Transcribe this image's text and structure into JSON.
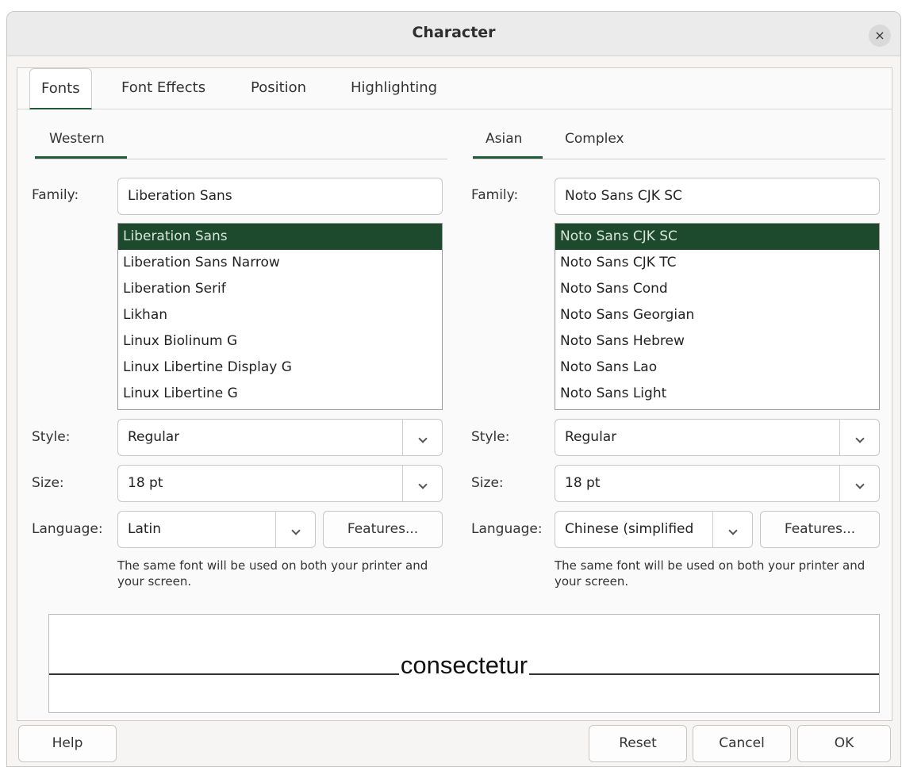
{
  "window": {
    "title": "Character",
    "close_symbol": "×"
  },
  "tabs": [
    "Fonts",
    "Font Effects",
    "Position",
    "Highlighting"
  ],
  "western": {
    "tab_label": "Western",
    "family_label": "Family:",
    "family_value": "Liberation Sans",
    "font_list": [
      "Liberation Sans",
      "Liberation Sans Narrow",
      "Liberation Serif",
      "Likhan",
      "Linux Biolinum G",
      "Linux Libertine Display G",
      "Linux Libertine G"
    ],
    "selected_index": 0,
    "style_label": "Style:",
    "style_value": "Regular",
    "size_label": "Size:",
    "size_value": "18 pt",
    "language_label": "Language:",
    "language_value": "Latin",
    "features_label": "Features...",
    "note": "The same font will be used on both your printer and your screen."
  },
  "asian": {
    "tab_label": "Asian",
    "complex_tab_label": "Complex",
    "family_label": "Family:",
    "family_value": "Noto Sans CJK SC",
    "font_list": [
      "Noto Sans CJK SC",
      "Noto Sans CJK TC",
      "Noto Sans Cond",
      "Noto Sans Georgian",
      "Noto Sans Hebrew",
      "Noto Sans Lao",
      "Noto Sans Light"
    ],
    "selected_index": 0,
    "style_label": "Style:",
    "style_value": "Regular",
    "size_label": "Size:",
    "size_value": "18 pt",
    "language_label": "Language:",
    "language_value": "Chinese (simplified",
    "features_label": "Features...",
    "note": "The same font will be used on both your printer and your screen."
  },
  "preview": {
    "text": "consectetur"
  },
  "buttons": {
    "help": "Help",
    "reset": "Reset",
    "cancel": "Cancel",
    "ok": "OK"
  },
  "colors": {
    "accent": "#1f5b36",
    "selection": "#1d4a2c"
  }
}
